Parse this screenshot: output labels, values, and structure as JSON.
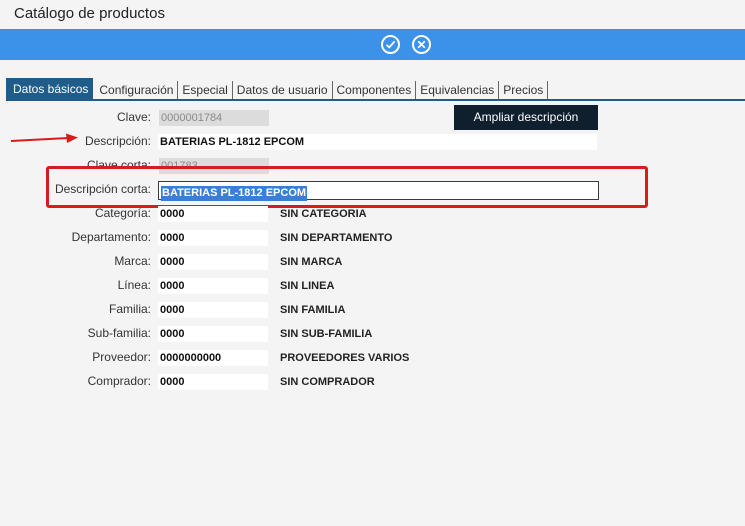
{
  "window": {
    "title": "Catálogo de productos"
  },
  "toolbar": {
    "accept_icon": "check-circle-icon",
    "cancel_icon": "x-circle-icon",
    "color": "#3c92e8"
  },
  "tabs": [
    {
      "label": "Datos básicos",
      "active": true
    },
    {
      "label": "Configuración"
    },
    {
      "label": "Especial"
    },
    {
      "label": "Datos de usuario"
    },
    {
      "label": "Componentes"
    },
    {
      "label": "Equivalencias"
    },
    {
      "label": "Precios"
    }
  ],
  "form": {
    "clave": {
      "label": "Clave:",
      "value": "0000001784"
    },
    "descripcion": {
      "label": "Descripción:",
      "value": "BATERIAS PL-1812 EPCOM"
    },
    "clave_corta": {
      "label": "Clave corta:",
      "value": "001783"
    },
    "descripcion_corta": {
      "label": "Descripción corta:",
      "value": "BATERIAS PL-1812 EPCOM"
    },
    "categoria": {
      "label": "Categoría:",
      "code": "0000",
      "name": "SIN CATEGORIA"
    },
    "departamento": {
      "label": "Departamento:",
      "code": "0000",
      "name": "SIN DEPARTAMENTO"
    },
    "marca": {
      "label": "Marca:",
      "code": "0000",
      "name": "SIN MARCA"
    },
    "linea": {
      "label": "Línea:",
      "code": "0000",
      "name": "SIN LINEA"
    },
    "familia": {
      "label": "Familia:",
      "code": "0000",
      "name": "SIN FAMILIA"
    },
    "subfamilia": {
      "label": "Sub-familia:",
      "code": "0000",
      "name": "SIN SUB-FAMILIA"
    },
    "proveedor": {
      "label": "Proveedor:",
      "code": "0000000000",
      "name": "PROVEEDORES VARIOS"
    },
    "comprador": {
      "label": "Comprador:",
      "code": "0000",
      "name": "SIN COMPRADOR"
    }
  },
  "buttons": {
    "ampliar": "Ampliar descripción"
  },
  "annotations": {
    "highlight_color": "#d61c1c"
  }
}
